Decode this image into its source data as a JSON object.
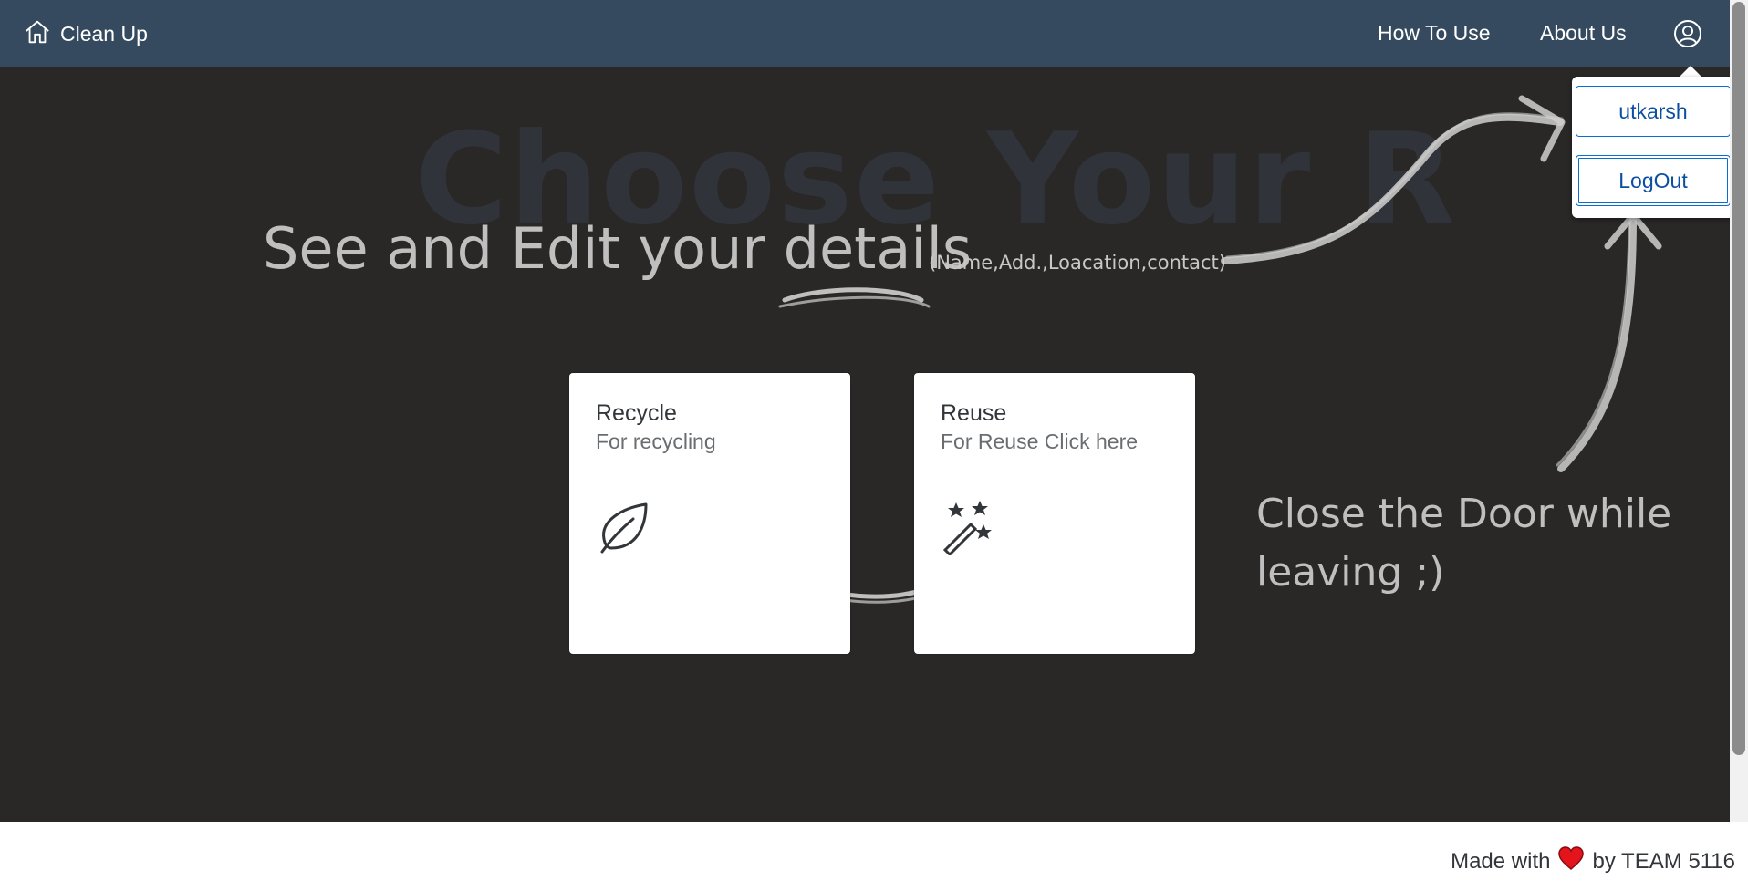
{
  "header": {
    "brand_label": "Clean Up",
    "nav": {
      "how_to_use": "How To Use",
      "about_us": "About Us"
    },
    "icons": {
      "home": "home-icon",
      "account": "user-account-icon"
    },
    "background_color": "#354a5f"
  },
  "main": {
    "heading": "Choose Your R",
    "annotations": {
      "edit_details": "See and Edit your details",
      "edit_details_note": "(Name,Add.,Loacation,contact)",
      "close_door": "Close the Door while leaving ;)"
    },
    "tiles": [
      {
        "title": "Recycle",
        "subtitle": "For recycling",
        "icon": "leaf-icon"
      },
      {
        "title": "Reuse",
        "subtitle": "For Reuse Click here",
        "icon": "magic-wand-icon"
      }
    ],
    "background_color": "#292827"
  },
  "user_menu": {
    "username": "utkarsh",
    "logout_label": "LogOut"
  },
  "footer": {
    "made_with": "Made with",
    "by_team": "by TEAM 5116",
    "icon": "heart-icon"
  }
}
